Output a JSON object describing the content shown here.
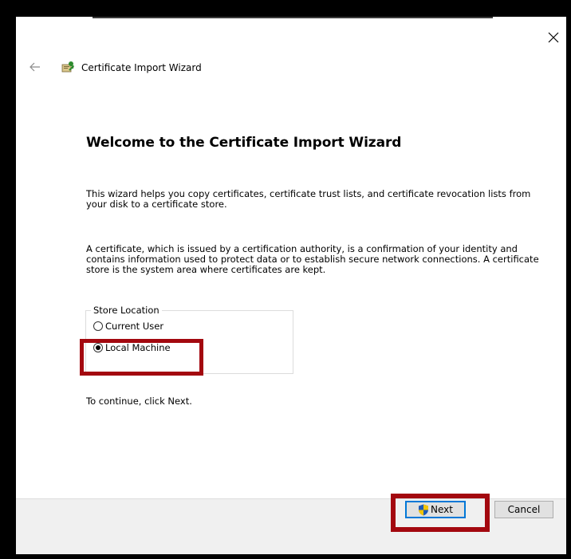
{
  "window": {
    "title": "Certificate Import Wizard"
  },
  "content": {
    "heading": "Welcome to the Certificate Import Wizard",
    "paragraph1": "This wizard helps you copy certificates, certificate trust lists, and certificate revocation lists from your disk to a certificate store.",
    "paragraph2": "A certificate, which is issued by a certification authority, is a confirmation of your identity and contains information used to protect data or to establish secure network connections. A certificate store is the system area where certificates are kept.",
    "store_location": {
      "legend": "Store Location",
      "options": [
        {
          "label": "Current User",
          "selected": false
        },
        {
          "label": "Local Machine",
          "selected": true
        }
      ]
    },
    "continue_text": "To continue, click Next."
  },
  "footer": {
    "next_label": "Next",
    "cancel_label": "Cancel"
  },
  "colors": {
    "highlight": "#a3080f",
    "focus_border": "#0078d7"
  }
}
